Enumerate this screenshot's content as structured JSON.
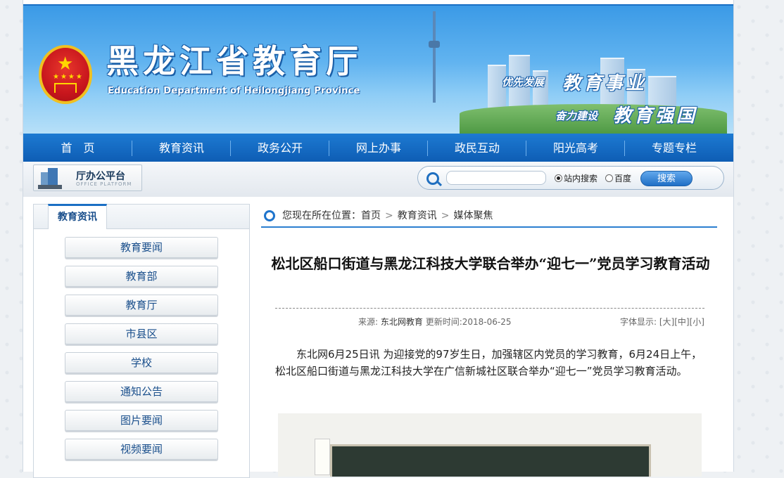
{
  "header": {
    "title": "黑龙江省教育厅",
    "subtitle": "Education Department of Heilongjiang Province",
    "slogan_1_small": "优先发展",
    "slogan_1_large": "教育事业",
    "slogan_2_small": "奋力建设",
    "slogan_2_large": "教育强国"
  },
  "nav": {
    "items": [
      {
        "label": "首　页"
      },
      {
        "label": "教育资讯"
      },
      {
        "label": "政务公开"
      },
      {
        "label": "网上办事"
      },
      {
        "label": "政民互动"
      },
      {
        "label": "阳光高考"
      },
      {
        "label": "专题专栏"
      }
    ]
  },
  "toolbar": {
    "office_title": "厅办公平台",
    "office_sub": "OFFICE PLATFORM",
    "search_placeholder": "",
    "radio_site": "站内搜索",
    "radio_baidu": "百度",
    "search_button": "搜索"
  },
  "sidebar": {
    "tab": "教育资讯",
    "items": [
      {
        "label": "教育要闻"
      },
      {
        "label": "教育部"
      },
      {
        "label": "教育厅"
      },
      {
        "label": "市县区"
      },
      {
        "label": "学校"
      },
      {
        "label": "通知公告"
      },
      {
        "label": "图片要闻"
      },
      {
        "label": "视频要闻"
      }
    ]
  },
  "breadcrumb": {
    "prefix": "您现在所在位置：",
    "home": "首页",
    "sep": ">",
    "level1": "教育资讯",
    "level2": "媒体聚焦"
  },
  "article": {
    "title": "松北区船口街道与黑龙江科技大学联合举办“迎七一”党员学习教育活动",
    "source_label": "来源:",
    "source": "东北网教育",
    "time_label": "更新时间:",
    "time": "2018-06-25",
    "font_label": "字体显示:",
    "font_large": "[大]",
    "font_medium": "[中]",
    "font_small": "[小]",
    "body": "东北网6月25日讯 为迎接党的97岁生日，加强辖区内党员的学习教育，6月24日上午，松北区船口街道与黑龙江科技大学在广信新城社区联合举办“迎七一”党员学习教育活动。"
  },
  "colors": {
    "brand_blue": "#1a6fc4",
    "nav_blue": "#0e5db4",
    "link_blue": "#1a4f8c"
  }
}
